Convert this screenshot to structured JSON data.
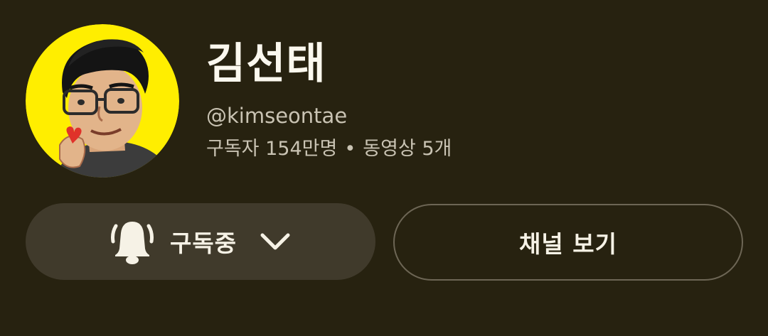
{
  "channel": {
    "name": "김선태",
    "handle": "@kimseontae",
    "subscribers": "구독자 154만명",
    "separator": "•",
    "videos": "동영상 5개"
  },
  "actions": {
    "subscribe_label": "구독중",
    "view_channel_label": "채널 보기"
  },
  "icons": {
    "avatar": "avatar-illustration",
    "bell": "bell-notification-icon",
    "chevron": "chevron-down-icon"
  },
  "colors": {
    "background": "#272210",
    "avatar_background": "#ffee00",
    "subscribe_button": "#403a2b",
    "outline_button_border": "#6d6655",
    "primary_text": "#fbf8ee",
    "secondary_text": "#c9c3b3"
  }
}
